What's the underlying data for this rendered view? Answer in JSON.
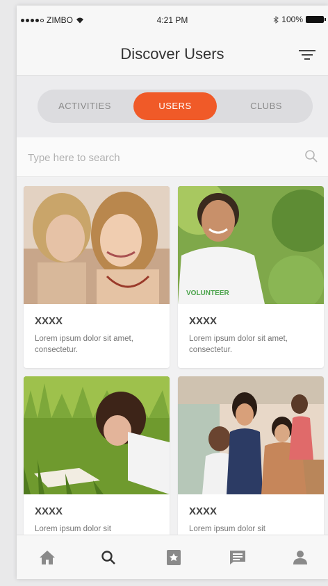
{
  "status_bar": {
    "carrier": "ZIMBO",
    "time": "4:21 PM",
    "battery": "100%"
  },
  "header": {
    "title": "Discover Users"
  },
  "tabs": [
    {
      "label": "ACTIVITIES",
      "active": false
    },
    {
      "label": "USERS",
      "active": true
    },
    {
      "label": "CLUBS",
      "active": false
    }
  ],
  "search": {
    "placeholder": "Type here to search"
  },
  "users": [
    {
      "name": "XXXX",
      "description": "Lorem ipsum dolor sit amet, consectetur."
    },
    {
      "name": "XXXX",
      "description": "Lorem ipsum dolor sit amet, consectetur.",
      "shirt_text": "VOLUNTEER"
    },
    {
      "name": "XXXX",
      "description": "Lorem ipsum dolor sit"
    },
    {
      "name": "XXXX",
      "description": "Lorem ipsum dolor sit"
    }
  ],
  "bottom_nav": [
    "home-icon",
    "search-icon",
    "bookmark-icon",
    "messages-icon",
    "profile-icon"
  ],
  "colors": {
    "accent": "#f05a28",
    "background": "#f1f1f2",
    "card": "#ffffff"
  }
}
